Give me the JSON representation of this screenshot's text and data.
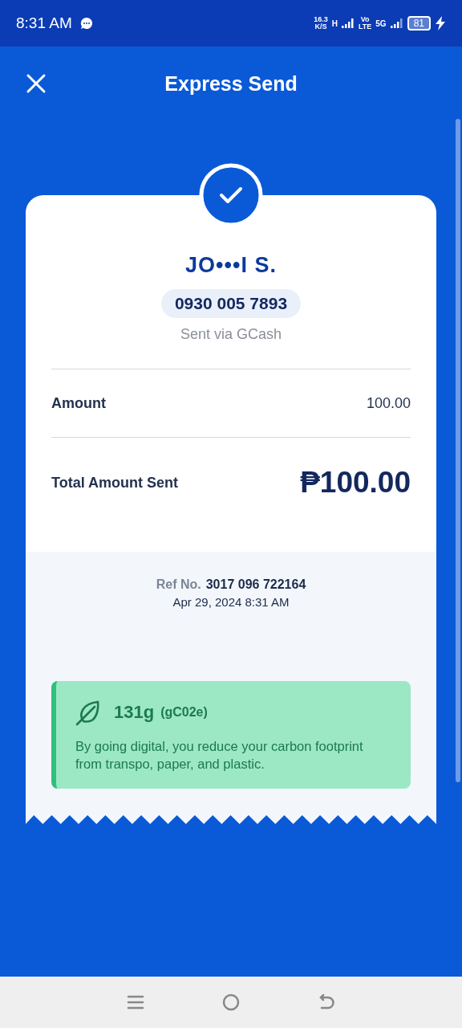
{
  "status_bar": {
    "time": "8:31 AM",
    "net_speed": "16.3",
    "net_unit": "K/S",
    "net_1": "H",
    "volte_top": "Vo",
    "volte_bottom": "LTE",
    "net_2": "5G",
    "battery": "81"
  },
  "header": {
    "title": "Express Send"
  },
  "recipient": {
    "name": "JO•••I S.",
    "phone": "0930 005 7893",
    "via": "Sent via GCash"
  },
  "amount": {
    "label": "Amount",
    "value": "100.00"
  },
  "total": {
    "label": "Total Amount Sent",
    "value": "₱100.00"
  },
  "reference": {
    "label": "Ref No.",
    "number": "3017 096 722164",
    "date": "Apr 29, 2024 8:31 AM"
  },
  "carbon": {
    "amount": "131g",
    "unit": "(gC02e)",
    "message": "By going digital, you reduce your carbon footprint from transpo, paper, and plastic."
  }
}
